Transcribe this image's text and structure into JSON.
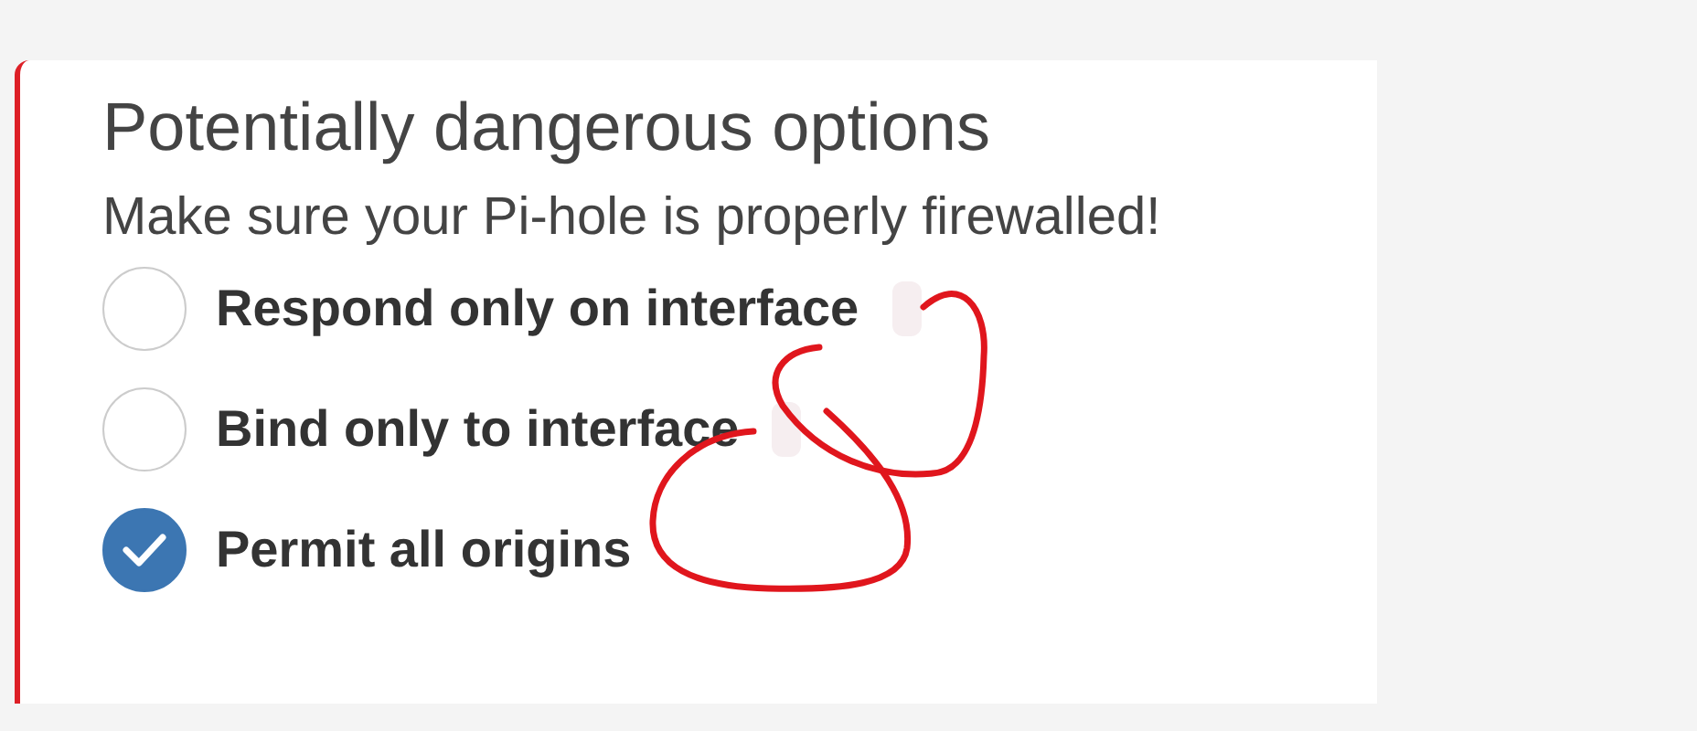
{
  "panel": {
    "title": "Potentially dangerous options",
    "subtitle": "Make sure your Pi-hole is properly firewalled!"
  },
  "options": [
    {
      "label": "Respond only on interface",
      "selected": false,
      "redacted": true
    },
    {
      "label": "Bind only to interface",
      "selected": false,
      "redacted": true
    },
    {
      "label": "Permit all origins",
      "selected": true,
      "redacted": false
    }
  ]
}
